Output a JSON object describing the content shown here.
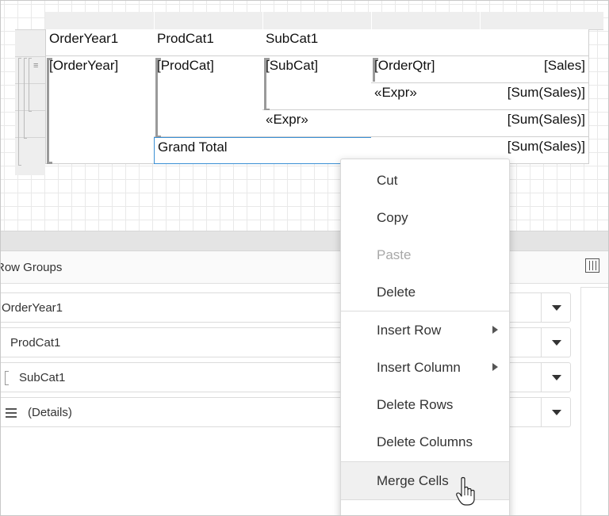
{
  "tablix": {
    "header_row": [
      "OrderYear1",
      "ProdCat1",
      "SubCat1",
      "",
      ""
    ],
    "cells": {
      "order_year": "[OrderYear]",
      "prod_cat": "[ProdCat]",
      "sub_cat": "[SubCat]",
      "order_qtr": "[OrderQtr]",
      "sales": "[Sales]",
      "expr_qtr": "«Expr»",
      "sum_sales_1": "[Sum(Sales)]",
      "expr_subcat": "«Expr»",
      "sum_sales_2": "[Sum(Sales)]",
      "grand_total": "Grand Total",
      "sum_sales_3": "[Sum(Sales)]"
    }
  },
  "groups_panel": {
    "title": "Row Groups",
    "rows": [
      {
        "label": "OrderYear1"
      },
      {
        "label": "ProdCat1"
      },
      {
        "label": "SubCat1"
      },
      {
        "label": "(Details)"
      }
    ]
  },
  "context_menu": {
    "items": [
      {
        "label": "Cut",
        "disabled": false
      },
      {
        "label": "Copy",
        "disabled": false
      },
      {
        "label": "Paste",
        "disabled": true
      },
      {
        "label": "Delete",
        "disabled": false
      },
      {
        "label": "Insert Row",
        "submenu": true
      },
      {
        "label": "Insert Column",
        "submenu": true
      },
      {
        "label": "Delete Rows",
        "disabled": false
      },
      {
        "label": "Delete Columns",
        "disabled": false
      },
      {
        "label": "Merge Cells",
        "hover": true
      }
    ]
  },
  "icons": {
    "cursor": "hand-pointer-icon",
    "column_groups": "column-groups-icon",
    "details": "details-lines-icon"
  },
  "colors": {
    "selection": "#3a8fd4",
    "menu_hover": "#f0f0f0"
  }
}
